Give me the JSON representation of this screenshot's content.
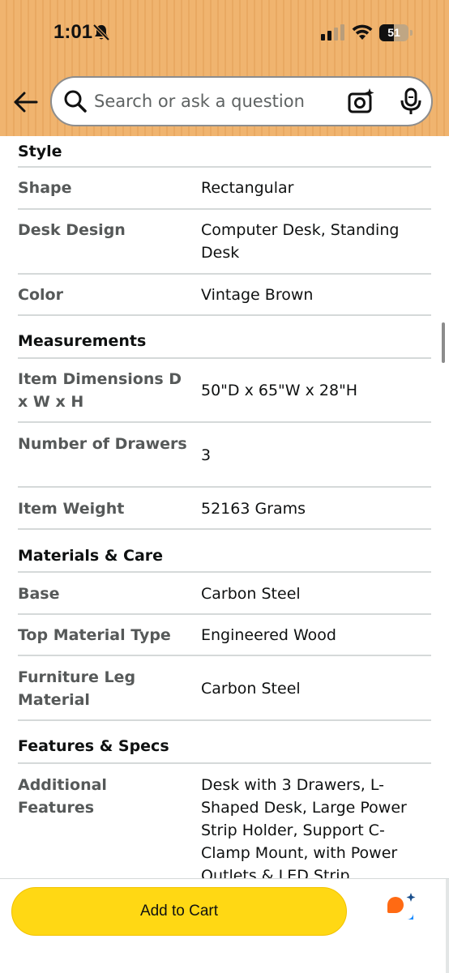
{
  "status_bar": {
    "time": "1:01",
    "battery_percent": "51",
    "battery_level": 0.51
  },
  "search": {
    "placeholder": "Search or ask a question"
  },
  "icons": {
    "back": "back-arrow-icon",
    "search": "search-icon",
    "camera": "camera-sparkle-icon",
    "mic": "microphone-icon",
    "bell": "bell-muted-icon",
    "rufus": "rufus-assistant-icon"
  },
  "sections": [
    {
      "heading": "Style",
      "rows": [
        {
          "label": "Shape",
          "value": "Rectangular"
        },
        {
          "label": "Desk Design",
          "value": "Computer Desk, Standing Desk"
        },
        {
          "label": "Color",
          "value": "Vintage Brown"
        }
      ]
    },
    {
      "heading": "Measurements",
      "rows": [
        {
          "label": "Item Dimensions D x W x H",
          "value": "50\"D x 65\"W x 28\"H"
        },
        {
          "label": "Number of Drawers",
          "value": "3"
        },
        {
          "label": "Item Weight",
          "value": "52163 Grams"
        }
      ]
    },
    {
      "heading": "Materials & Care",
      "rows": [
        {
          "label": "Base",
          "value": "Carbon Steel"
        },
        {
          "label": "Top Material Type",
          "value": "Engineered Wood"
        },
        {
          "label": "Furniture Leg Material",
          "value": "Carbon Steel"
        }
      ]
    },
    {
      "heading": "Features & Specs",
      "rows": [
        {
          "label": "Additional Features",
          "value": "Desk with 3 Drawers, L-Shaped Desk, Large Power Strip Holder, Support C-Clamp Mount, with Power Outlets & LED Strip"
        }
      ]
    }
  ],
  "bottom_bar": {
    "add_to_cart_label": "Add to Cart"
  },
  "colors": {
    "header_bg": "#f0b46f",
    "add_to_cart_bg": "#ffd814",
    "label_text": "#565959",
    "value_text": "#0f1111",
    "divider": "#d5d9d9",
    "rufus_orange": "#ff6a13",
    "rufus_blue": "#1a8cff"
  }
}
